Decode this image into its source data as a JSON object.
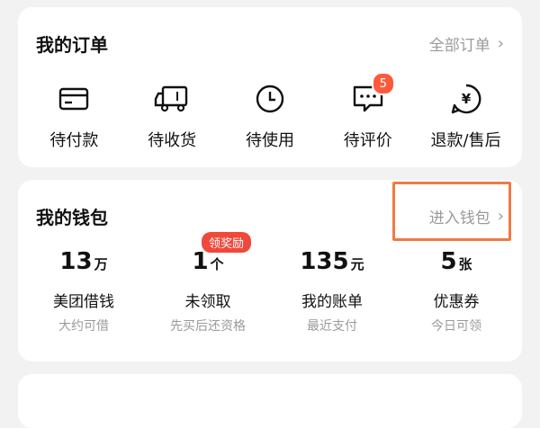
{
  "orders": {
    "title": "我的订单",
    "all_link": "全部订单",
    "items": [
      {
        "label": "待付款",
        "icon": "card-icon"
      },
      {
        "label": "待收货",
        "icon": "truck-icon"
      },
      {
        "label": "待使用",
        "icon": "clock-icon"
      },
      {
        "label": "待评价",
        "icon": "comment-icon",
        "badge": "5"
      },
      {
        "label": "退款/售后",
        "icon": "refund-icon"
      }
    ]
  },
  "wallet": {
    "title": "我的钱包",
    "enter_link": "进入钱包",
    "promo_badge": "领奖励",
    "items": [
      {
        "value": "13",
        "unit": "万",
        "label": "美团借钱",
        "sub": "大约可借"
      },
      {
        "value": "1",
        "unit": "个",
        "label": "未领取",
        "sub": "先买后还资格"
      },
      {
        "value": "135",
        "unit": "元",
        "label": "我的账单",
        "sub": "最近支付"
      },
      {
        "value": "5",
        "unit": "张",
        "label": "优惠券",
        "sub": "今日可领"
      }
    ]
  },
  "third_card": {
    "title": "",
    "link": ""
  },
  "colors": {
    "accent": "#f07a44",
    "badge": "#ff5a3c",
    "promo": "#f0483b"
  }
}
